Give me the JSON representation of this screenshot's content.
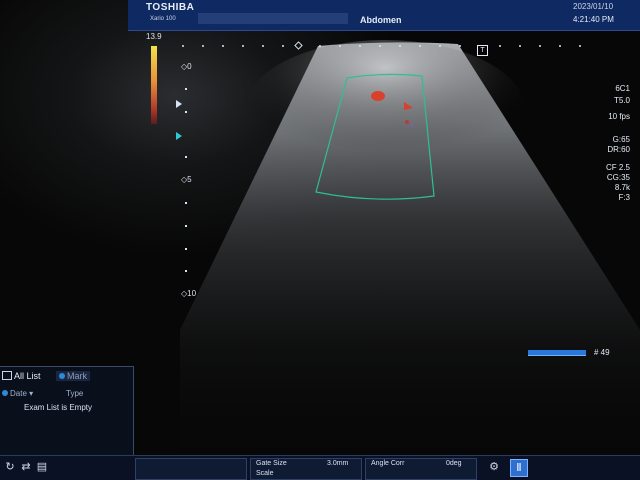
{
  "header": {
    "brand": "TOSHIBA",
    "model": "Xario 100",
    "study": "Abdomen",
    "date": "2023/01/10",
    "time": "4:21:40 PM"
  },
  "color_scale": {
    "max_value": "13.9"
  },
  "depth_scale": {
    "labels": [
      "0",
      "5",
      "10"
    ]
  },
  "transducer_marker": "T",
  "params": {
    "probe": "6C1",
    "preset": "T5.0",
    "fps": "10 fps",
    "gain": "G:65",
    "dynamic_range": "DR:60",
    "color_freq": "CF 2.5",
    "color_gain": "CG:35",
    "prf": "8.7k",
    "filter": "F:3"
  },
  "cine": {
    "frame_label": "# 49",
    "progress": 0.95
  },
  "exam_list": {
    "tab_all": "All List",
    "tab_mark": "Mark",
    "col_date": "Date",
    "col_type": "Type",
    "empty_message": "Exam List is Empty"
  },
  "bottom_bar": {
    "gate_size_label": "Gate Size",
    "gate_size_value": "3.0mm",
    "scale_label": "Scale",
    "angle_corr_label": "Angle Corr",
    "angle_corr_value": "0deg"
  },
  "colors": {
    "header_bg": "#0f2a63",
    "doppler_red": "#d9402e",
    "roi_box": "#2fbf8f",
    "accent_blue": "#2f6fd0"
  }
}
